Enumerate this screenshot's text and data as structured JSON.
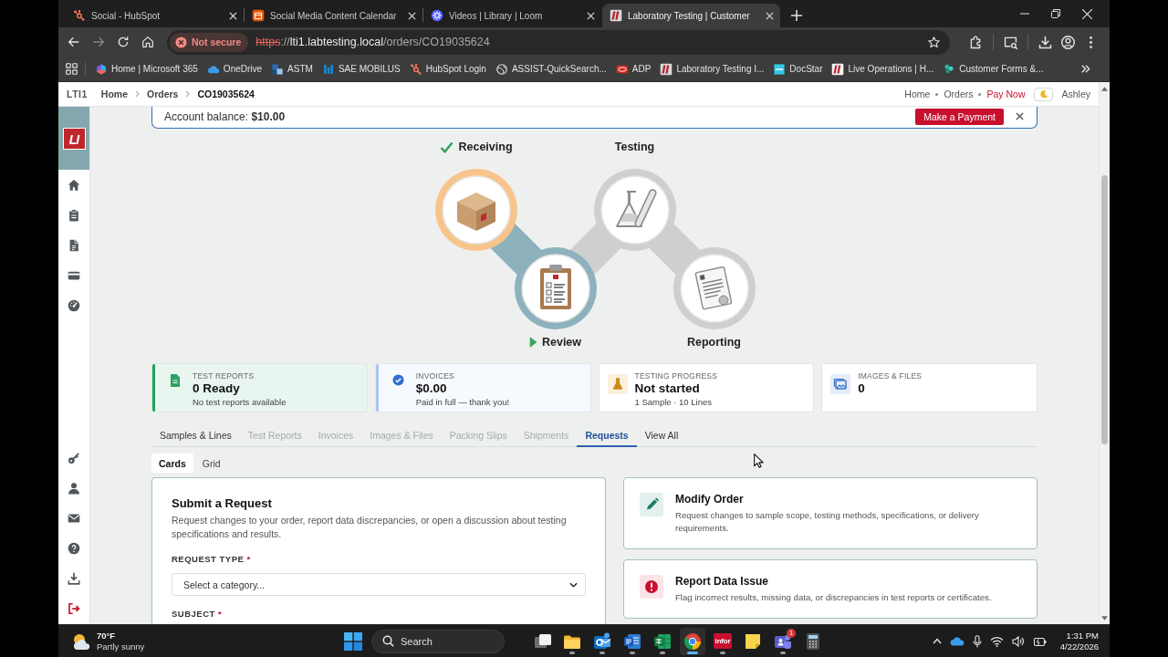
{
  "browser": {
    "tabs": [
      {
        "title": "Social - HubSpot",
        "selected": false
      },
      {
        "title": "Social Media Content Calendar",
        "selected": false
      },
      {
        "title": "Videos | Library | Loom",
        "selected": false
      },
      {
        "title": "Laboratory Testing | Customer",
        "selected": true
      }
    ],
    "forward_disabled": true,
    "security": "Not secure",
    "url_parts": [
      {
        "text": "https",
        "kind": "scheme"
      },
      {
        "text": "://",
        "kind": "plain"
      },
      {
        "text": "lti1.labtesting.local",
        "kind": "host"
      },
      {
        "text": "/orders/CO19035624",
        "kind": "plain"
      }
    ],
    "bookmarks": [
      "Home | Microsoft 365",
      "OneDrive",
      "ASTM",
      "SAE MOBILUS",
      "HubSpot Login",
      "ASSIST-QuickSearch...",
      "ADP",
      "Laboratory Testing I...",
      "DocStar",
      "Live Operations | H...",
      "Customer Forms &..."
    ]
  },
  "header": {
    "brand": "LTI1",
    "breadcrumbs": [
      "Home",
      "Orders",
      "CO19035624"
    ],
    "links": [
      {
        "label": "Home",
        "kind": "link"
      },
      {
        "label": "Orders",
        "kind": "link"
      },
      {
        "label": "Pay Now",
        "kind": "accent"
      }
    ],
    "user": "Ashley"
  },
  "sidebar": {
    "logo": "LI"
  },
  "banner": {
    "text": "Account balance: **$10.00**",
    "button": "Make a Payment"
  },
  "steps": [
    {
      "label": "Receiving",
      "completed": true,
      "current": false
    },
    {
      "label": "Review",
      "completed": false,
      "current": true
    },
    {
      "label": "Testing",
      "completed": false,
      "current": false
    },
    {
      "label": "Reporting",
      "completed": false,
      "current": false
    }
  ],
  "stats": [
    {
      "label": "TEST REPORTS",
      "value": "0 Ready",
      "note": "No test reports available",
      "color": "#23a05a"
    },
    {
      "label": "INVOICES",
      "value": "$0.00",
      "note": "Paid in full — thank you!",
      "color": "#a8c7ec"
    },
    {
      "label": "TESTING PROGRESS",
      "value": "Not started",
      "note": "1 Sample · 10 Lines"
    },
    {
      "label": "IMAGES & FILES",
      "value": "0"
    }
  ],
  "tabs": [
    {
      "label": "Samples & Lines",
      "selected": false,
      "disabled": false
    },
    {
      "label": "Test Reports",
      "selected": false,
      "disabled": true
    },
    {
      "label": "Invoices",
      "selected": false,
      "disabled": true
    },
    {
      "label": "Images & Files",
      "selected": false,
      "disabled": true
    },
    {
      "label": "Packing Slips",
      "selected": false,
      "disabled": true
    },
    {
      "label": "Shipments",
      "selected": false,
      "disabled": true
    },
    {
      "label": "Requests",
      "selected": true,
      "disabled": false
    },
    {
      "label": "View All",
      "selected": false,
      "disabled": false
    }
  ],
  "view_toggle": [
    {
      "label": "Cards",
      "selected": true
    },
    {
      "label": "Grid",
      "selected": false
    }
  ],
  "request_form": {
    "title": "Submit a Request",
    "description": "Request changes to your order, report data discrepancies, or open a discussion about testing specifications and results.",
    "fields": [
      {
        "label": "REQUEST TYPE",
        "required_mark": "*",
        "placeholder": "Select a category..."
      },
      {
        "label": "SUBJECT",
        "required_mark": "*"
      }
    ]
  },
  "actions": [
    {
      "title": "Modify Order",
      "description": "Request changes to sample scope, testing methods, specifications, or delivery requirements."
    },
    {
      "title": "Report Data Issue",
      "description": "Flag incorrect results, missing data, or discrepancies in test reports or certificates."
    }
  ],
  "taskbar": {
    "weather": {
      "temperature": "70°F",
      "condition": "Partly sunny"
    },
    "search_placeholder": "Search",
    "apps": [
      {
        "running": false,
        "selected": false
      },
      {
        "running": true,
        "selected": false
      },
      {
        "running": true,
        "selected": false
      },
      {
        "running": true,
        "selected": false
      },
      {
        "running": true,
        "selected": false
      },
      {
        "running": true,
        "selected": true
      },
      {
        "running": true,
        "selected": false,
        "label": "infor"
      },
      {
        "running": false,
        "selected": false
      },
      {
        "running": true,
        "selected": false,
        "badge": "1"
      },
      {
        "running": false,
        "selected": false
      }
    ],
    "clock": {
      "time": "1:31 PM",
      "date": "4/22/2026"
    }
  }
}
